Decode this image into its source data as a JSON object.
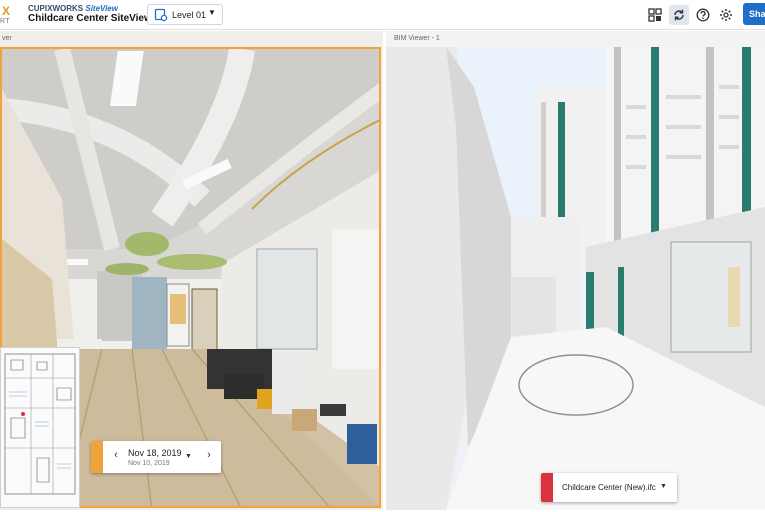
{
  "header": {
    "logo_letter": "X",
    "logo_sub": "RT",
    "brand_main": "CUPIXWORKS",
    "brand_sub": "SiteView",
    "project_title": "Childcare Center SiteView",
    "level": "Level 01",
    "share_label": "Share"
  },
  "left_pane": {
    "title": "ver"
  },
  "right_pane": {
    "title": "BIM Viewer - 1"
  },
  "capture_date": {
    "current": "Nov 18, 2019",
    "compare": "Nov 10, 2019"
  },
  "model": {
    "name": "Childcare Center (New).ifc"
  },
  "colors": {
    "accent_orange": "#f0a33a",
    "accent_blue": "#1f6fc8",
    "model_red": "#d8333f"
  },
  "icons": [
    "layers-icon",
    "sync-icon",
    "help-icon",
    "settings-icon",
    "level-pin-icon",
    "chevron-left-icon",
    "chevron-right-icon",
    "caret-down-icon"
  ]
}
